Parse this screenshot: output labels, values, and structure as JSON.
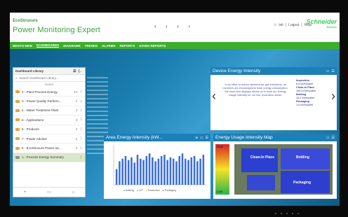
{
  "header": {
    "brand_small": "EcoStruxure",
    "brand_title": "Power Monitoring Expert",
    "user": "init",
    "links": [
      "Logout",
      "Help"
    ],
    "company": "Schneider",
    "company_sub": "Electric"
  },
  "nav": [
    "WHATS NEW",
    "DASHBOARDS",
    "DIAGRAMS",
    "TRENDS",
    "ALARMS",
    "REPORTS",
    "SAVED REPORTS"
  ],
  "library": {
    "title": "Dashboard Library",
    "search_placeholder": "Search Dashboard Library...",
    "root": "Home",
    "items": [
      {
        "label": "2 - Plant Process Energy",
        "count": "10"
      },
      {
        "label": "3 - Power Quality Perform...",
        "count": "2"
      },
      {
        "label": "4 - Water Treatment Plant",
        "count": "2"
      },
      {
        "label": "5 - Applications",
        "count": "8"
      },
      {
        "label": "6 - Products",
        "count": "4"
      },
      {
        "label": "7 - Power Advisor",
        "count": "2"
      },
      {
        "label": "8 - EcoStruxure Power Ap...",
        "count": "5"
      },
      {
        "label": "1 - Process Energy Summary",
        "count": ""
      }
    ]
  },
  "device_panel": {
    "title": "Device Energy Intensity",
    "message": "In an effort to reduce greenhouse gas emissions, all members are encouraged to track energy consumption. We track how displays allows us to track our Energy Usage Intensity for our four production areas:",
    "list": [
      {
        "name": "Inspection",
        "value": "6.6 kWh/pallet"
      },
      {
        "name": "Clean-In-Place",
        "value": "168.5 kWh/pallet"
      },
      {
        "name": "Bottling",
        "value": "16.2 kWh/pallet"
      },
      {
        "name": "Packaging",
        "value": "1.6 kWh/pallet"
      }
    ]
  },
  "area_panel": {
    "title": "Area Energy Intensity (kW...",
    "legend": [
      "Bottling",
      "CIP",
      "Production",
      "Packaging"
    ]
  },
  "eui_panel": {
    "title": "Energy Usage Intensity Map",
    "high": "High",
    "low": "Low",
    "areas": [
      "Clean-In Place",
      "Bottling",
      "Packaging"
    ]
  },
  "chart_data": {
    "type": "bar",
    "title": "Area Energy Intensity (kW...",
    "values": [
      12,
      18,
      20,
      22,
      19,
      21,
      17,
      23,
      20,
      19,
      22,
      24,
      21,
      18,
      20,
      22,
      23,
      19,
      21,
      20,
      18,
      22,
      24,
      20,
      19,
      21,
      22,
      18,
      20,
      23
    ],
    "ylim": [
      0,
      30
    ]
  }
}
